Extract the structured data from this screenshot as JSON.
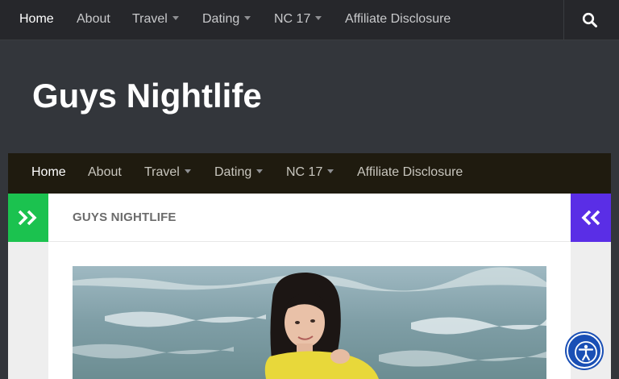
{
  "top_nav": {
    "items": [
      {
        "label": "Home"
      },
      {
        "label": "About"
      },
      {
        "label": "Travel"
      },
      {
        "label": "Dating"
      },
      {
        "label": "NC 17"
      },
      {
        "label": "Affiliate Disclosure"
      }
    ],
    "active": "Home",
    "search_icon": "search-icon"
  },
  "header": {
    "site_title": "Guys Nightlife"
  },
  "main_nav": {
    "items": [
      {
        "label": "Home"
      },
      {
        "label": "About"
      },
      {
        "label": "Travel"
      },
      {
        "label": "Dating"
      },
      {
        "label": "NC 17"
      },
      {
        "label": "Affiliate Disclosure"
      }
    ],
    "active": "Home"
  },
  "sidebar_toggles": {
    "left_icon": "double-chevron-right-icon",
    "right_icon": "double-chevron-left-icon"
  },
  "page": {
    "heading": "GUYS NIGHTLIFE"
  },
  "accessibility": {
    "icon": "accessibility-icon"
  },
  "colors": {
    "header_bg": "#33363b",
    "top_nav_bg": "#26272b",
    "main_nav_bg": "#1f1b0f",
    "left_toggle": "#1bc24f",
    "right_toggle": "#5a2ee6",
    "a11y_button": "#1a4fb5"
  }
}
